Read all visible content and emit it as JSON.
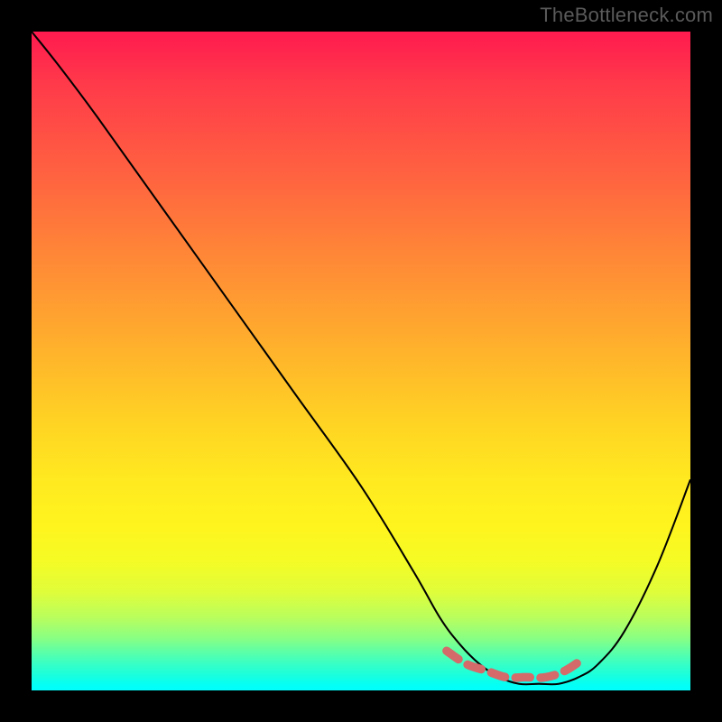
{
  "watermark": "TheBottleneck.com",
  "chart_data": {
    "type": "line",
    "title": "",
    "xlabel": "",
    "ylabel": "",
    "xlim": [
      0,
      100
    ],
    "ylim": [
      0,
      100
    ],
    "series": [
      {
        "name": "bottleneck-curve",
        "x": [
          0,
          4,
          10,
          20,
          30,
          40,
          50,
          58,
          62,
          65,
          68,
          71,
          74,
          77,
          80,
          83,
          86,
          90,
          95,
          100
        ],
        "values": [
          100,
          95,
          87,
          73,
          59,
          45,
          31,
          18,
          11,
          7,
          4,
          2,
          1,
          1,
          1,
          2,
          4,
          9,
          19,
          32
        ]
      },
      {
        "name": "optimal-band-marker",
        "x": [
          63,
          66,
          69,
          72,
          75,
          78,
          81,
          84
        ],
        "values": [
          6.0,
          4.0,
          3.0,
          2.0,
          2.0,
          2.0,
          3.0,
          5.0
        ]
      }
    ],
    "annotations": []
  },
  "colors": {
    "curve": "#000000",
    "marker": "#d46a6a",
    "background_top": "#ff1a4f",
    "background_bottom": "#00fffc"
  }
}
